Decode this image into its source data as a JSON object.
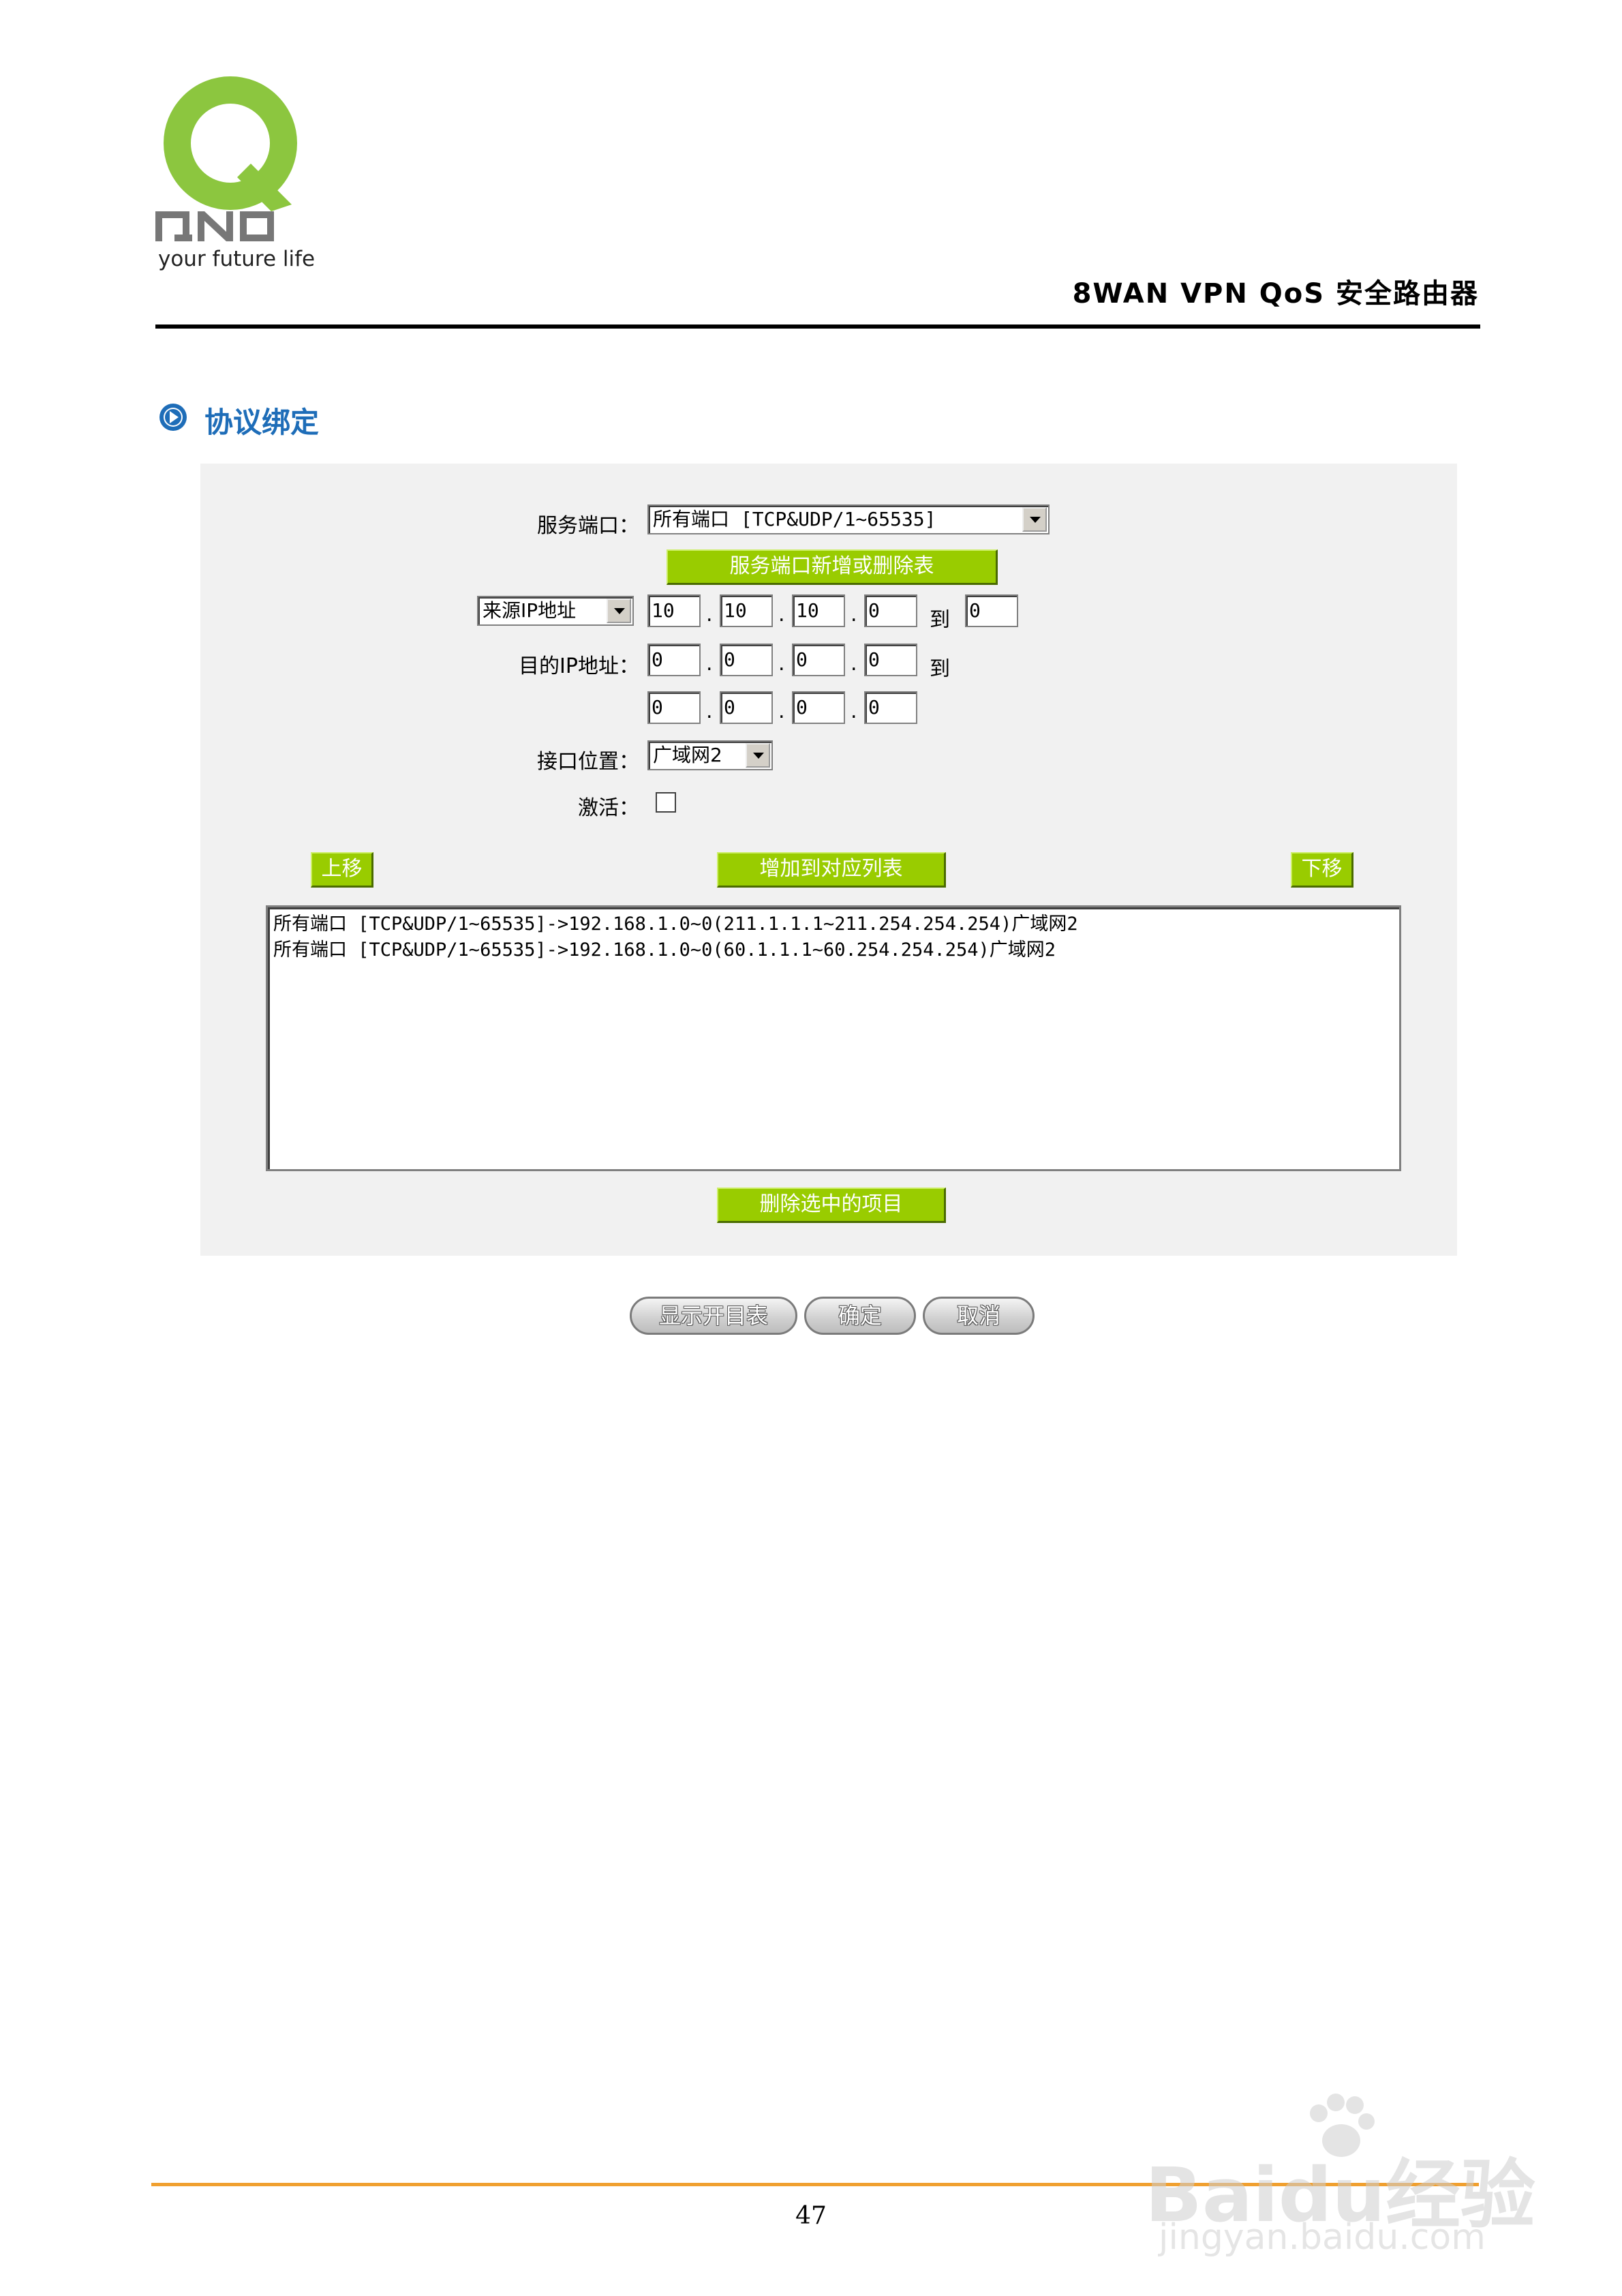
{
  "logo": {
    "brand": "QNO",
    "tagline": "your future life",
    "colors": {
      "green": "#8cc63f",
      "grey": "#777777"
    }
  },
  "header": {
    "product_title": "8WAN VPN QoS 安全路由器"
  },
  "section": {
    "icon": "circle-arrow-right-icon",
    "title": "协议绑定"
  },
  "form": {
    "service_port_label": "服务端口：",
    "service_port_value": "所有端口 [TCP&UDP/1~65535]",
    "service_table_button": "服务端口新增或删除表",
    "source_ip_select": "来源IP地址",
    "source_ip": [
      "10",
      "10",
      "10",
      "0"
    ],
    "source_ip_to_label": "到",
    "source_ip_end": "0",
    "dest_ip_label": "目的IP地址：",
    "dest_ip_start": [
      "0",
      "0",
      "0",
      "0"
    ],
    "dest_ip_to_label": "到",
    "dest_ip_end": [
      "0",
      "0",
      "0",
      "0"
    ],
    "interface_label": "接口位置：",
    "interface_value": "广域网2",
    "enable_label": "激活：",
    "enable_checked": false
  },
  "actions": {
    "move_up": "上移",
    "add_to_list": "增加到对应列表",
    "move_down": "下移",
    "delete_selected": "删除选中的项目"
  },
  "rules_list": [
    "所有端口 [TCP&UDP/1~65535]->192.168.1.0~0(211.1.1.1~211.254.254.254)广域网2",
    "所有端口 [TCP&UDP/1~65535]->192.168.1.0~0(60.1.1.1~60.254.254.254)广域网2"
  ],
  "bottom_buttons": {
    "show_table": "显示开目表",
    "ok": "确定",
    "cancel": "取消"
  },
  "footer": {
    "page_number": "47",
    "rule_color": "#f0a030"
  },
  "watermark": {
    "text": "Baidu经验",
    "url": "jingyan.baidu.com"
  }
}
